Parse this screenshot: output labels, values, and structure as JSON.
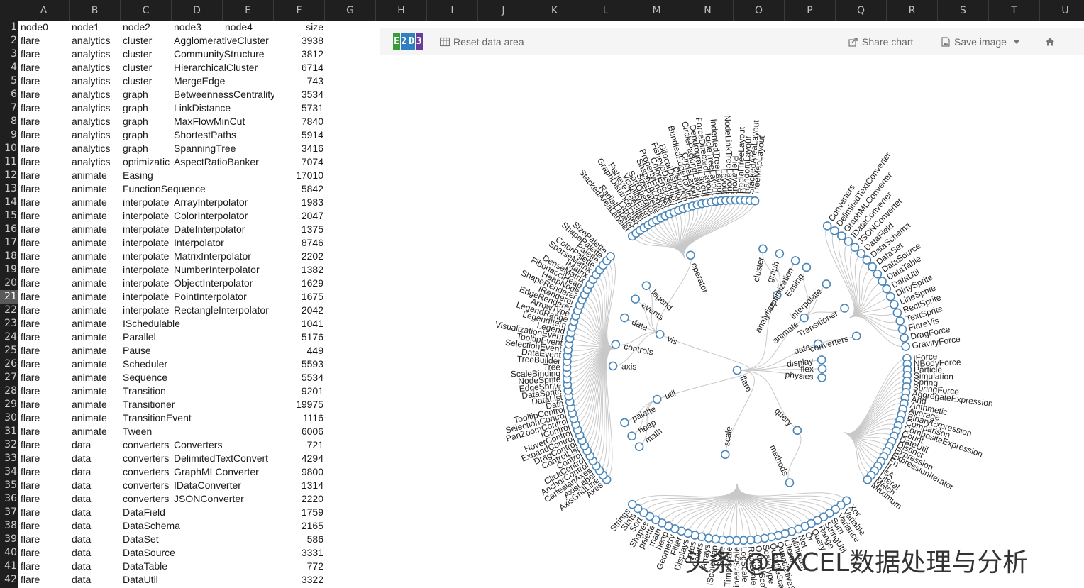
{
  "columns": [
    "A",
    "B",
    "C",
    "D",
    "E",
    "F",
    "G",
    "H",
    "I",
    "J",
    "K",
    "L",
    "M",
    "N",
    "O",
    "P",
    "Q",
    "R",
    "S",
    "T",
    "U"
  ],
  "active_row": 21,
  "header_row": [
    "node0",
    "node1",
    "node2",
    "node3",
    "node4",
    "size"
  ],
  "rows": [
    [
      "flare",
      "analytics",
      "cluster",
      "AgglomerativeCluster",
      "",
      "3938"
    ],
    [
      "flare",
      "analytics",
      "cluster",
      "CommunityStructure",
      "",
      "3812"
    ],
    [
      "flare",
      "analytics",
      "cluster",
      "HierarchicalCluster",
      "",
      "6714"
    ],
    [
      "flare",
      "analytics",
      "cluster",
      "MergeEdge",
      "",
      "743"
    ],
    [
      "flare",
      "analytics",
      "graph",
      "BetweennessCentrality",
      "",
      "3534"
    ],
    [
      "flare",
      "analytics",
      "graph",
      "LinkDistance",
      "",
      "5731"
    ],
    [
      "flare",
      "analytics",
      "graph",
      "MaxFlowMinCut",
      "",
      "7840"
    ],
    [
      "flare",
      "analytics",
      "graph",
      "ShortestPaths",
      "",
      "5914"
    ],
    [
      "flare",
      "analytics",
      "graph",
      "SpanningTree",
      "",
      "3416"
    ],
    [
      "flare",
      "analytics",
      "optimizatic",
      "AspectRatioBanker",
      "",
      "7074"
    ],
    [
      "flare",
      "animate",
      "Easing",
      "",
      "",
      "17010"
    ],
    [
      "flare",
      "animate",
      "FunctionSequence",
      "",
      "",
      "5842"
    ],
    [
      "flare",
      "animate",
      "interpolate",
      "ArrayInterpolator",
      "",
      "1983"
    ],
    [
      "flare",
      "animate",
      "interpolate",
      "ColorInterpolator",
      "",
      "2047"
    ],
    [
      "flare",
      "animate",
      "interpolate",
      "DateInterpolator",
      "",
      "1375"
    ],
    [
      "flare",
      "animate",
      "interpolate",
      "Interpolator",
      "",
      "8746"
    ],
    [
      "flare",
      "animate",
      "interpolate",
      "MatrixInterpolator",
      "",
      "2202"
    ],
    [
      "flare",
      "animate",
      "interpolate",
      "NumberInterpolator",
      "",
      "1382"
    ],
    [
      "flare",
      "animate",
      "interpolate",
      "ObjectInterpolator",
      "",
      "1629"
    ],
    [
      "flare",
      "animate",
      "interpolate",
      "PointInterpolator",
      "",
      "1675"
    ],
    [
      "flare",
      "animate",
      "interpolate",
      "RectangleInterpolator",
      "",
      "2042"
    ],
    [
      "flare",
      "animate",
      "ISchedulable",
      "",
      "",
      "1041"
    ],
    [
      "flare",
      "animate",
      "Parallel",
      "",
      "",
      "5176"
    ],
    [
      "flare",
      "animate",
      "Pause",
      "",
      "",
      "449"
    ],
    [
      "flare",
      "animate",
      "Scheduler",
      "",
      "",
      "5593"
    ],
    [
      "flare",
      "animate",
      "Sequence",
      "",
      "",
      "5534"
    ],
    [
      "flare",
      "animate",
      "Transition",
      "",
      "",
      "9201"
    ],
    [
      "flare",
      "animate",
      "Transitioner",
      "",
      "",
      "19975"
    ],
    [
      "flare",
      "animate",
      "TransitionEvent",
      "",
      "",
      "1116"
    ],
    [
      "flare",
      "animate",
      "Tween",
      "",
      "",
      "6006"
    ],
    [
      "flare",
      "data",
      "converters",
      "Converters",
      "",
      "721"
    ],
    [
      "flare",
      "data",
      "converters",
      "DelimitedTextConvert",
      "",
      "4294"
    ],
    [
      "flare",
      "data",
      "converters",
      "GraphMLConverter",
      "",
      "9800"
    ],
    [
      "flare",
      "data",
      "converters",
      "IDataConverter",
      "",
      "1314"
    ],
    [
      "flare",
      "data",
      "converters",
      "JSONConverter",
      "",
      "2220"
    ],
    [
      "flare",
      "data",
      "DataField",
      "",
      "",
      "1759"
    ],
    [
      "flare",
      "data",
      "DataSchema",
      "",
      "",
      "2165"
    ],
    [
      "flare",
      "data",
      "DataSet",
      "",
      "",
      "586"
    ],
    [
      "flare",
      "data",
      "DataSource",
      "",
      "",
      "3331"
    ],
    [
      "flare",
      "data",
      "DataTable",
      "",
      "",
      "772"
    ],
    [
      "flare",
      "data",
      "DataUtil",
      "",
      "",
      "3322"
    ]
  ],
  "toolbar": {
    "reset_label": "Reset data area",
    "share_label": "Share chart",
    "save_label": "Save image",
    "logo_letters": [
      "E",
      "2",
      "D",
      "3"
    ],
    "logo_colors": [
      "#3a9d3a",
      "#2f7fc1",
      "#2f7fc1",
      "#6a3d9a"
    ]
  },
  "tree": {
    "root": "flare",
    "groups": [
      {
        "name": "analytics",
        "angle": -62,
        "r": 120,
        "children": [
          {
            "name": "cluster",
            "angle": -78,
            "r": 175,
            "leaves": [
              "AgglomerativeCluster",
              "CommunityStructure",
              "HierarchicalCluster",
              "MergeEdge"
            ]
          },
          {
            "name": "graph",
            "angle": -70,
            "r": 175,
            "leaves": [
              "BetweennessCentrality",
              "LinkDistance",
              "MaxFlowMinCut",
              "ShortestPaths",
              "SpanningTree"
            ]
          },
          {
            "name": "optimization",
            "angle": -62,
            "r": 175,
            "leaves": [
              "AspectRatioBanker"
            ]
          }
        ]
      },
      {
        "name": "animate",
        "angle": -38,
        "r": 120,
        "children": [
          {
            "name": "Easing",
            "angle": -56,
            "r": 175,
            "leaves": []
          },
          {
            "name": "interpolate",
            "angle": -44,
            "r": 175,
            "leaves": [
              "ArrayInterpolator",
              "ColorInterpolator",
              "DateInterpolator",
              "Interpolator",
              "MatrixInterpolator",
              "NumberInterpolator",
              "ObjectInterpolator",
              "PointInterpolator",
              "RectangleInterpolator"
            ]
          },
          {
            "name": "Transitioner",
            "angle": -30,
            "r": 175,
            "leaves": []
          }
        ]
      },
      {
        "name": "data",
        "angle": -18,
        "r": 120,
        "children": [
          {
            "name": "converters",
            "angle": -16,
            "r": 175,
            "leaves": [
              "Converters",
              "DelimitedTextConverter",
              "GraphMLConverter",
              "IDataConverter",
              "JSONConverter"
            ]
          }
        ]
      },
      {
        "name": "display",
        "angle": -7,
        "r": 120,
        "children": []
      },
      {
        "name": "flex",
        "angle": -1,
        "r": 120,
        "children": []
      },
      {
        "name": "physics",
        "angle": 5,
        "r": 120,
        "children": []
      },
      {
        "name": "query",
        "angle": 45,
        "r": 120,
        "children": [
          {
            "name": "methods",
            "angle": 65,
            "r": 175,
            "leaves": []
          }
        ]
      },
      {
        "name": "scale",
        "angle": 98,
        "r": 120,
        "children": []
      },
      {
        "name": "util",
        "angle": 160,
        "r": 120,
        "children": [
          {
            "name": "heap",
            "angle": 148,
            "r": 175,
            "leaves": []
          },
          {
            "name": "math",
            "angle": 142,
            "r": 175,
            "leaves": []
          },
          {
            "name": "palette",
            "angle": 155,
            "r": 175,
            "leaves": []
          }
        ]
      },
      {
        "name": "vis",
        "angle": -155,
        "r": 120,
        "children": [
          {
            "name": "axis",
            "angle": -178,
            "r": 175,
            "leaves": [
              "Axes",
              "AxisGridLine",
              "AxisLabel",
              "CartesianAxes"
            ]
          },
          {
            "name": "controls",
            "angle": -168,
            "r": 175,
            "leaves": [
              "AnchorControl",
              "ClickControl",
              "Control",
              "DragControl",
              "ExpandControl",
              "HoverControl",
              "PanZoomControl",
              "SelectionControl",
              "TooltipControl"
            ]
          },
          {
            "name": "data",
            "angle": -155,
            "r": 175,
            "leaves": [
              "Data",
              "DataList",
              "DataSprite",
              "EdgeSprite",
              "NodeSprite",
              "ScaleBinding",
              "Tree",
              "TreeBuilder"
            ]
          },
          {
            "name": "events",
            "angle": -145,
            "r": 175,
            "leaves": [
              "DataEvent",
              "SelectionEvent",
              "TooltipEvent",
              "VisualizationEvent"
            ]
          },
          {
            "name": "legend",
            "angle": -137,
            "r": 175,
            "leaves": [
              "Legend",
              "LegendItem",
              "LegendRange"
            ]
          },
          {
            "name": "operator",
            "angle": -112,
            "r": 175,
            "leaves": []
          }
        ]
      }
    ],
    "outer_labels_top": [
      "StackedAreaLabeler",
      "RadialLabeler",
      "Labeler",
      "GraphDistanceFilter",
      "FisheyeTreeFilter",
      "VisibilityFilter",
      "SortOperator",
      "SizePalette",
      "ShapeEncoder",
      "PropertyEncoder",
      "ColorEncoder",
      "FisheyeDistortion",
      "BifocalDistortion",
      "Distortion",
      "BundledEdgeRouter",
      "CircleLayout",
      "CirclePackingLayout",
      "DendrogramLayout",
      "ForceDirectedLayout",
      "IcicleTreeLayout",
      "IndentedTreeLayout",
      "Layout",
      "NodeLinkTreeLayout",
      "PieLayout",
      "RadialTreeLayout",
      "RandomLayout",
      "StackedAreaLayout",
      "TreeMapLayout"
    ],
    "outer_labels_right": [
      "Converters",
      "DelimitedTextConverter",
      "GraphMLConverter",
      "IDataConverter",
      "JSONConverter",
      "DataField",
      "DataSchema",
      "DataSet",
      "DataSource",
      "DataTable",
      "DataUtil",
      "DirtySprite",
      "LineSprite",
      "RectSprite",
      "TextSprite",
      "FlareVis",
      "DragForce",
      "GravityForce",
      "IForce",
      "NBodyForce",
      "Particle",
      "Simulation",
      "Spring",
      "SpringForce",
      "AggregateExpression",
      "And",
      "Arithmetic",
      "Average",
      "BinaryExpression",
      "Comparison",
      "CompositeExpression",
      "Count",
      "DateUtil",
      "Distinct",
      "Expression",
      "ExpressionIterator",
      "Fn",
      "If",
      "IsA",
      "Literal",
      "Match",
      "Maximum"
    ],
    "outer_labels_bottom": [
      "Xor",
      "Variable",
      "Variance",
      "Sum",
      "StringUtil",
      "Range",
      "Query",
      "Or",
      "Not",
      "Minimum",
      "Literal",
      "QuantitativeScale",
      "QuantileScale",
      "ScaleType",
      "OrdinalScale",
      "RootScale",
      "LogScale",
      "LinearScale",
      "TimeScale",
      "Scale",
      "IScaleMap",
      "Arrays",
      "Colors",
      "Dates",
      "Displays",
      "Filter",
      "Geometry",
      "heap",
      "math",
      "palette",
      "Shapes",
      "Sort",
      "Stats",
      "Strings"
    ],
    "outer_labels_left": [
      "Axes",
      "AxisGridLine",
      "AxisLabel",
      "CartesianAxes",
      "AnchorControl",
      "ClickControl",
      "Control",
      "ControlList",
      "DragControl",
      "ExpandControl",
      "HoverControl",
      "IControl",
      "PanZoomControl",
      "SelectionControl",
      "TooltipControl",
      "Data",
      "DataList",
      "DataSprite",
      "EdgeSprite",
      "NodeSprite",
      "ScaleBinding",
      "Tree",
      "TreeBuilder",
      "DataEvent",
      "SelectionEvent",
      "TooltipEvent",
      "VisualizationEvent",
      "Legend",
      "LegendItem",
      "LegendRange",
      "ArrowType",
      "EdgeRenderer",
      "IRenderer",
      "ShapeRenderer",
      "HeapNode",
      "FibonacciHeap",
      "DenseMatrix",
      "IMatrix",
      "SparseMatrix",
      "ColorPalette",
      "Palette",
      "ShapePalette",
      "SizePalette"
    ]
  },
  "colors": {
    "node_stroke": "#4a86b8",
    "link": "#c8c8c8"
  },
  "watermark": "头条 @EXCEL数据处理与分析"
}
